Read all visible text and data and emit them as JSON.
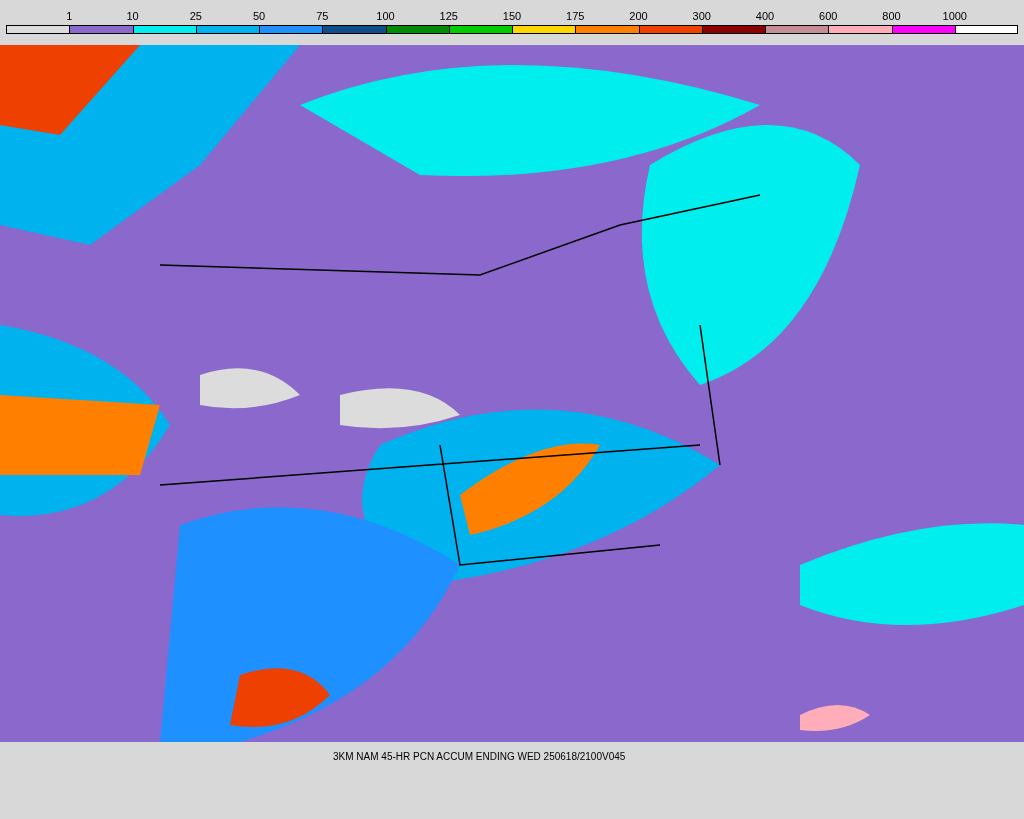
{
  "legend": {
    "segments": [
      {
        "color": "#dcdcdc",
        "label": "1"
      },
      {
        "color": "#8b68cc",
        "label": "10"
      },
      {
        "color": "#00eeee",
        "label": "25"
      },
      {
        "color": "#00b2ee",
        "label": "50"
      },
      {
        "color": "#1e90ff",
        "label": "75"
      },
      {
        "color": "#104e8b",
        "label": "100"
      },
      {
        "color": "#008b00",
        "label": "125"
      },
      {
        "color": "#00cd00",
        "label": "150"
      },
      {
        "color": "#ffd700",
        "label": "175"
      },
      {
        "color": "#ff8000",
        "label": "200"
      },
      {
        "color": "#ee4000",
        "label": "300"
      },
      {
        "color": "#8b0000",
        "label": "400"
      },
      {
        "color": "#c48c96",
        "label": "600"
      },
      {
        "color": "#ffaeb9",
        "label": "800"
      },
      {
        "color": "#ff00ff",
        "label": "1000"
      },
      {
        "color": "#ffffff"
      }
    ]
  },
  "caption": "3KM NAM 45-HR PCN ACCUM ENDING WED 250618/2100V045"
}
